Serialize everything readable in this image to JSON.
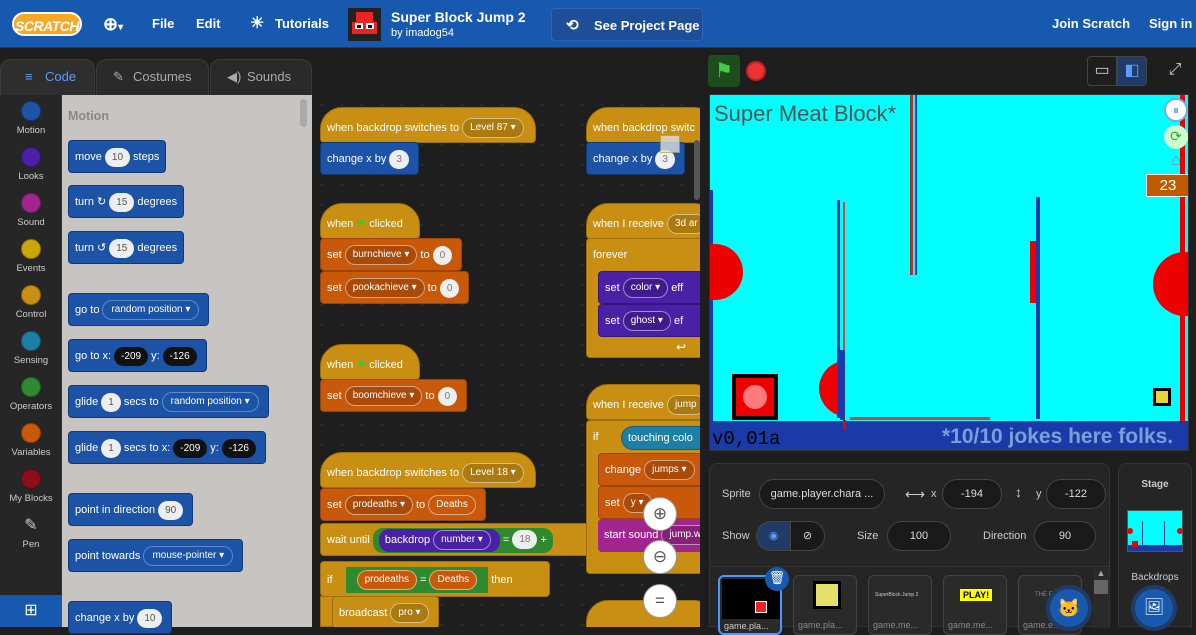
{
  "header": {
    "logo": "SCRATCH",
    "menu": [
      "File",
      "Edit"
    ],
    "tutorials": "Tutorials",
    "project_title": "Super Block Jump 2",
    "project_author": "by imadog54",
    "see_project": "See Project Page",
    "join": "Join Scratch",
    "signin": "Sign in"
  },
  "tabs": {
    "code": "Code",
    "costumes": "Costumes",
    "sounds": "Sounds"
  },
  "categories": [
    {
      "label": "Motion",
      "color": "#1d53a6"
    },
    {
      "label": "Looks",
      "color": "#4a20a6"
    },
    {
      "label": "Sound",
      "color": "#a0258f"
    },
    {
      "label": "Events",
      "color": "#c9a708"
    },
    {
      "label": "Control",
      "color": "#c88f13"
    },
    {
      "label": "Sensing",
      "color": "#1c7fa6"
    },
    {
      "label": "Operators",
      "color": "#2f8a2f"
    },
    {
      "label": "Variables",
      "color": "#c8580a"
    },
    {
      "label": "My Blocks",
      "color": "#8a0e1c"
    },
    {
      "label": "Pen",
      "color": "#1e1e1e"
    }
  ],
  "palette": {
    "title": "Motion",
    "move": {
      "a": "move",
      "v": "10",
      "b": "steps"
    },
    "turn_cw": {
      "a": "turn",
      "v": "15",
      "b": "degrees"
    },
    "turn_ccw": {
      "a": "turn",
      "v": "15",
      "b": "degrees"
    },
    "goto": {
      "a": "go to",
      "v": "random position"
    },
    "gotoxy": {
      "a": "go to x:",
      "x": "-209",
      "b": "y:",
      "y": "-126"
    },
    "glide": {
      "a": "glide",
      "v": "1",
      "b": "secs to",
      "d": "random position"
    },
    "glidexy": {
      "a": "glide",
      "v": "1",
      "b": "secs to x:",
      "x": "-209",
      "c": "y:",
      "y": "-126"
    },
    "point_dir": {
      "a": "point in direction",
      "v": "90"
    },
    "point_towards": {
      "a": "point towards",
      "v": "mouse-pointer"
    },
    "changex": {
      "a": "change x by",
      "v": "10"
    }
  },
  "scripts": {
    "s1_hat": {
      "a": "when backdrop switches to",
      "v": "Level 87"
    },
    "s1_b1": {
      "a": "change x by",
      "v": "3"
    },
    "s2_hat": {
      "a": "when",
      "b": "clicked"
    },
    "s2_b1": {
      "a": "set",
      "d": "burnchieve",
      "b": "to",
      "v": "0"
    },
    "s2_b2": {
      "a": "set",
      "d": "pookachieve",
      "b": "to",
      "v": "0"
    },
    "s3_hat": {
      "a": "when",
      "b": "clicked"
    },
    "s3_b1": {
      "a": "set",
      "d": "boomchieve",
      "b": "to",
      "v": "0"
    },
    "s4_hat": {
      "a": "when backdrop switches to",
      "v": "Level 18"
    },
    "s4_b1": {
      "a": "set",
      "d": "prodeaths",
      "b": "to",
      "v": "Deaths"
    },
    "s4_b2": {
      "a": "wait until",
      "bd": "backdrop",
      "num": "number",
      "eq": "=",
      "v": "18",
      "plus": "+"
    },
    "s4_b3": {
      "a": "if",
      "l": "prodeaths",
      "eq": "=",
      "r": "Deaths",
      "b": "then"
    },
    "s4_b4": {
      "a": "broadcast",
      "d": "pro"
    },
    "r1_hat": {
      "a": "when backdrop switc"
    },
    "r1_b1": {
      "a": "change x by",
      "v": "3"
    },
    "r2_hat": {
      "a": "when I receive",
      "v": "3d ar"
    },
    "r2_b1": {
      "a": "forever"
    },
    "r2_b2": {
      "a": "set",
      "d": "color",
      "b": "eff"
    },
    "r2_b3": {
      "a": "set",
      "d": "ghost",
      "b": "ef"
    },
    "r3_hat": {
      "a": "when I receive",
      "v": "jump"
    },
    "r3_b1": {
      "a": "if",
      "b": "touching colo"
    },
    "r3_b2": {
      "a": "change",
      "d": "jumps"
    },
    "r3_b3": {
      "a": "set",
      "d": "y"
    },
    "r3_b4": {
      "a": "start sound",
      "d": "jump.w"
    }
  },
  "stage": {
    "title": "Super Meat Block*",
    "counter": "23",
    "version": "v0,01a",
    "footer": "*10/10 jokes here folks.",
    "bg": "#00ffff"
  },
  "sprite": {
    "label": "Sprite",
    "name": "game.player.chara ...",
    "x_label": "x",
    "x": "-194",
    "y_label": "y",
    "y": "-122",
    "show": "Show",
    "size_label": "Size",
    "size": "100",
    "dir_label": "Direction",
    "dir": "90",
    "thumbs": [
      "game.pla...",
      "game.pla...",
      "game.me...",
      "game.me...",
      "game.e..."
    ],
    "thumb_texts": [
      "",
      "",
      "SuperBlock Jump 2",
      "PLAY!",
      "THE E..."
    ]
  },
  "stage_panel": {
    "label": "Stage",
    "backdrops": "Backdrops"
  }
}
